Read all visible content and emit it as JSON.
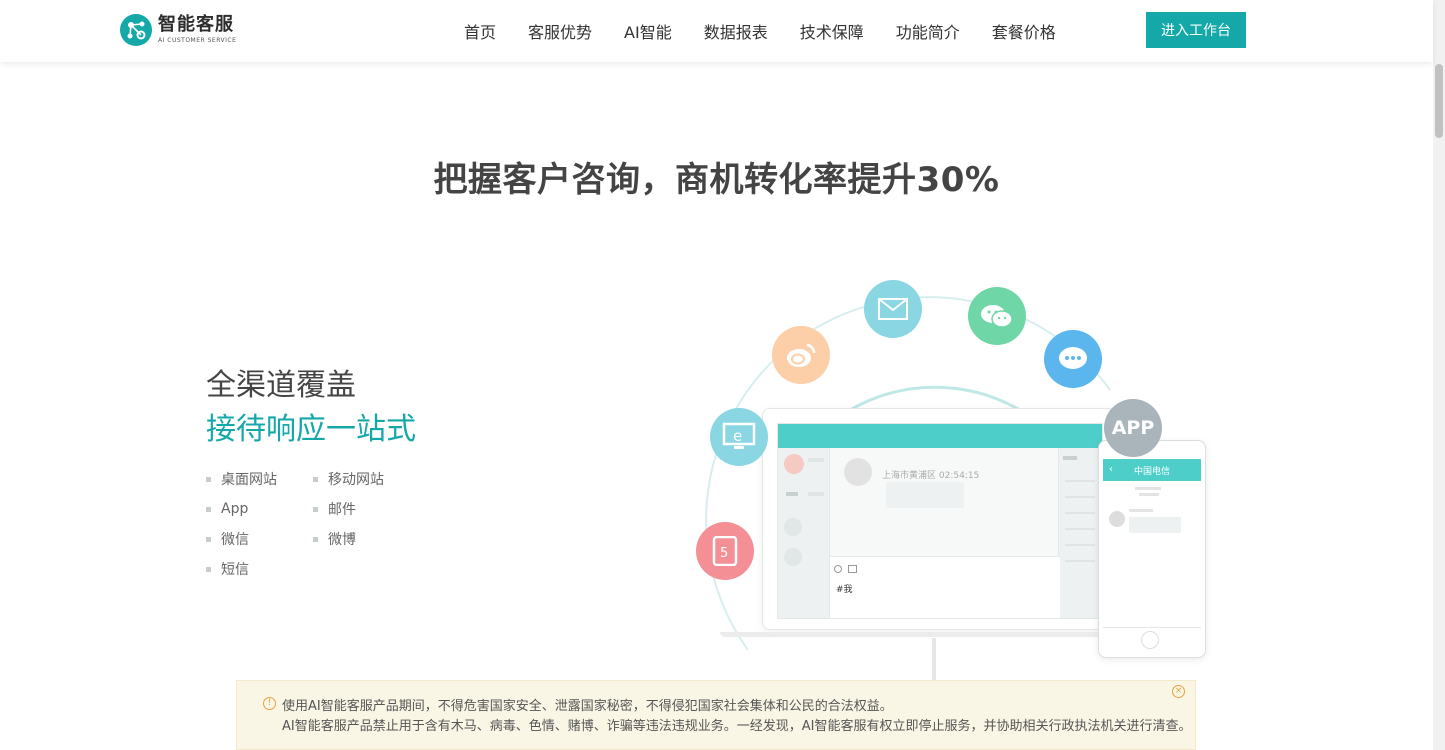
{
  "header": {
    "logo_cn": "智能客服",
    "logo_en": "AI CUSTOMER SERVICE",
    "nav": [
      "首页",
      "客服优势",
      "AI智能",
      "数据报表",
      "技术保障",
      "功能简介",
      "套餐价格"
    ],
    "cta_label": "进入工作台"
  },
  "hero": {
    "headline": "把握客户咨询，商机转化率提升30%"
  },
  "feature": {
    "title": "全渠道覆盖",
    "subtitle": "接待响应一站式",
    "channels": [
      "桌面网站",
      "移动网站",
      "App",
      "邮件",
      "微信",
      "微博",
      "短信"
    ]
  },
  "illustration": {
    "app_badge": "APP",
    "chat_location": "上海市黄浦区 02:54:15",
    "chat_input": "#我",
    "phone_title": "中国电信"
  },
  "colors": {
    "brand": "#14a8a8",
    "screen_bar": "#4dcec8",
    "notice_bg": "#faf6e6"
  },
  "notice": {
    "icon": "info-icon",
    "line1": "使用AI智能客服产品期间，不得危害国家安全、泄露国家秘密，不得侵犯国家社会集体和公民的合法权益。",
    "line2": "AI智能客服产品禁止用于含有木马、病毒、色情、赌博、诈骗等违法违规业务。一经发现，AI智能客服有权立即停止服务，并协助相关行政执法机关进行清查。"
  }
}
